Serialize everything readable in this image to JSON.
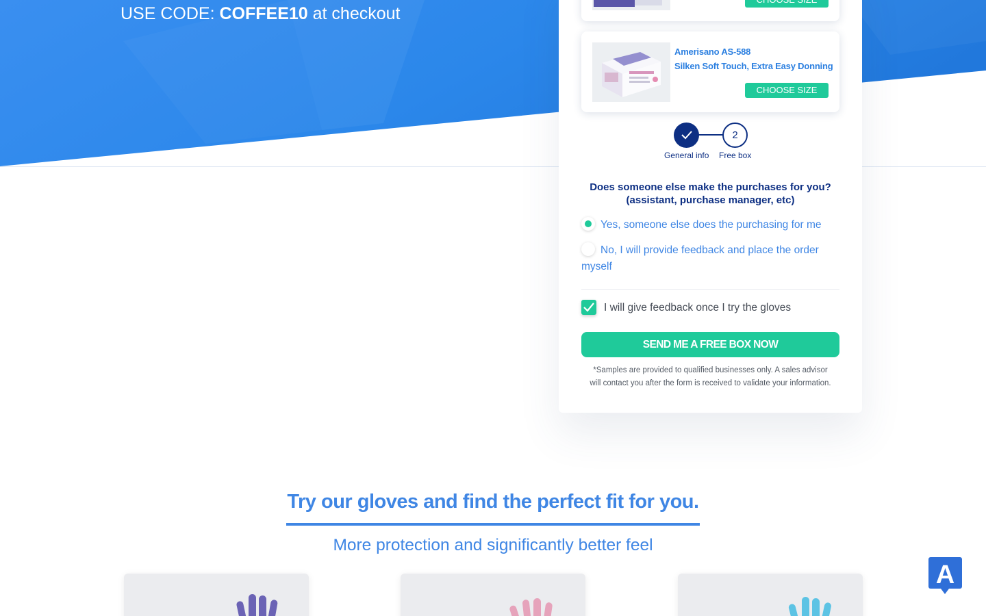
{
  "hero": {
    "promo_prefix": "USE CODE: ",
    "promo_code": "COFFEE10",
    "promo_suffix": " at checkout"
  },
  "products": [
    {
      "name_line1": "",
      "name_line2": "",
      "button_label": "CHOOSE SIZE",
      "thumb_icon": "glove-box-image"
    },
    {
      "name_line1": "Amerisano AS-588",
      "name_line2": "Silken Soft Touch, Extra Easy Donning",
      "button_label": "CHOOSE SIZE",
      "thumb_icon": "glove-box-image"
    }
  ],
  "stepper": {
    "steps": [
      {
        "label": "General info",
        "state": "done",
        "icon": "check-icon"
      },
      {
        "label": "Free box",
        "number": "2",
        "state": "current"
      }
    ]
  },
  "form": {
    "question_line1": "Does someone else make the purchases for you?",
    "question_line2": "(assistant, purchase manager, etc)",
    "options": [
      {
        "label": "Yes, someone else does the purchasing for me",
        "selected": true
      },
      {
        "label": "No, I will provide feedback and place the order myself",
        "selected": false
      }
    ],
    "feedback_checkbox_label": "I will give feedback once I try the gloves",
    "feedback_checked": true,
    "submit_label": "SEND ME A FREE BOX NOW",
    "disclaimer_line1": "*Samples are provided to qualified businesses only. A sales advisor",
    "disclaimer_line2": "will contact you after the form is received to validate your information."
  },
  "section": {
    "headline": "Try our gloves and find the perfect fit for you.",
    "subheadline": "More protection and significantly better feel"
  },
  "glove_cards": [
    {
      "icon": "purple-glove-image",
      "color": "#6b63b5"
    },
    {
      "icon": "pink-glove-image",
      "color": "#e6a3bb"
    },
    {
      "icon": "blue-glove-image",
      "color": "#5cc3e4"
    }
  ],
  "colors": {
    "hero_blue": "#2d86e8",
    "accent_green": "#1fca9a",
    "navy": "#0d2f83",
    "link_blue": "#3f86e4"
  },
  "widget": {
    "letter": "A",
    "icon": "support-chat-icon"
  }
}
